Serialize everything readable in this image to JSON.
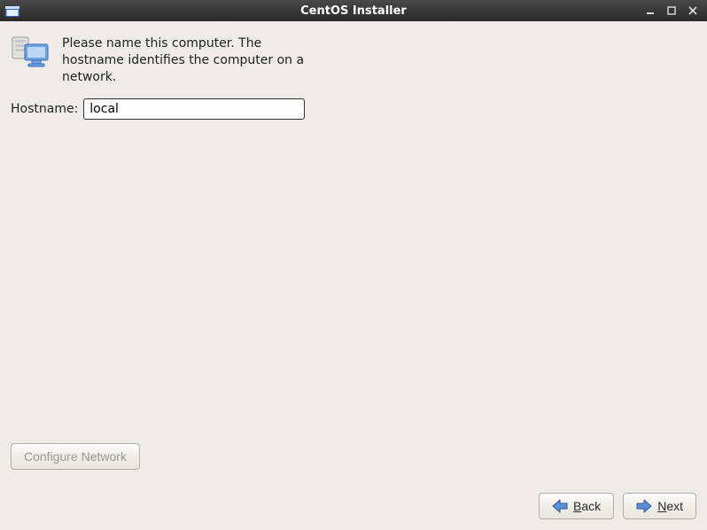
{
  "window": {
    "title": "CentOS Installer"
  },
  "intro": {
    "text": "Please name this computer.  The hostname identifies the computer on a network."
  },
  "hostname": {
    "label": "Hostname:",
    "value": "local"
  },
  "buttons": {
    "configure_network": "Configure Network",
    "back": "Back",
    "next": "Next"
  },
  "icons": {
    "app": "app-icon",
    "network": "network-computers-icon",
    "arrow_left": "arrow-left-icon",
    "arrow_right": "arrow-right-icon",
    "minimize": "minimize-icon",
    "maximize": "maximize-icon",
    "close": "close-icon"
  }
}
